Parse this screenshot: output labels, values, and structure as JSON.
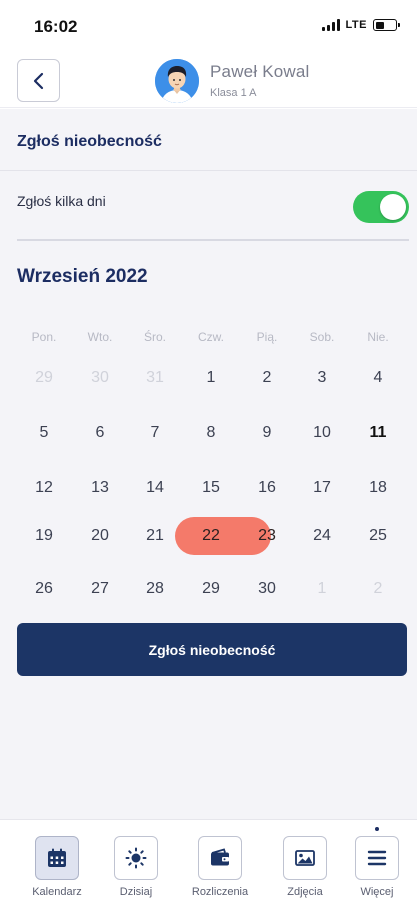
{
  "status_bar": {
    "time": "16:02",
    "network": "LTE"
  },
  "header": {
    "name": "Paweł Kowal",
    "class_label": "Klasa 1 A"
  },
  "page": {
    "title": "Zgłoś nieobecność",
    "multi_day_label": "Zgłoś kilka dni",
    "multi_day_enabled": true,
    "month": "Wrzesień 2022"
  },
  "calendar": {
    "weekdays": [
      "Pon.",
      "Wto.",
      "Śro.",
      "Czw.",
      "Pią.",
      "Sob.",
      "Nie."
    ],
    "weeks": [
      [
        {
          "d": "29",
          "m": true
        },
        {
          "d": "30",
          "m": true
        },
        {
          "d": "31",
          "m": true
        },
        {
          "d": "1"
        },
        {
          "d": "2"
        },
        {
          "d": "3"
        },
        {
          "d": "4"
        }
      ],
      [
        {
          "d": "5"
        },
        {
          "d": "6"
        },
        {
          "d": "7"
        },
        {
          "d": "8"
        },
        {
          "d": "9"
        },
        {
          "d": "10"
        },
        {
          "d": "11",
          "t": true
        }
      ],
      [
        {
          "d": "12"
        },
        {
          "d": "13"
        },
        {
          "d": "14"
        },
        {
          "d": "15"
        },
        {
          "d": "16"
        },
        {
          "d": "17"
        },
        {
          "d": "18"
        }
      ],
      [
        {
          "d": "19"
        },
        {
          "d": "20"
        },
        {
          "d": "21"
        },
        {
          "d": "22",
          "s": true
        },
        {
          "d": "23",
          "s": true
        },
        {
          "d": "24"
        },
        {
          "d": "25"
        }
      ],
      [
        {
          "d": "26"
        },
        {
          "d": "27"
        },
        {
          "d": "28"
        },
        {
          "d": "29"
        },
        {
          "d": "30"
        },
        {
          "d": "1",
          "m": true
        },
        {
          "d": "2",
          "m": true
        }
      ]
    ],
    "selection_color": "#f47a6a"
  },
  "submit_button": {
    "label": "Zgłoś nieobecność",
    "color": "#1c3566"
  },
  "bottom_nav": {
    "items": [
      {
        "label": "Kalendarz",
        "icon": "calendar-icon",
        "active": true
      },
      {
        "label": "Dzisiaj",
        "icon": "sun-icon"
      },
      {
        "label": "Rozliczenia",
        "icon": "wallet-icon"
      },
      {
        "label": "Zdjęcia",
        "icon": "image-icon"
      },
      {
        "label": "Więcej",
        "icon": "menu-icon"
      }
    ]
  }
}
